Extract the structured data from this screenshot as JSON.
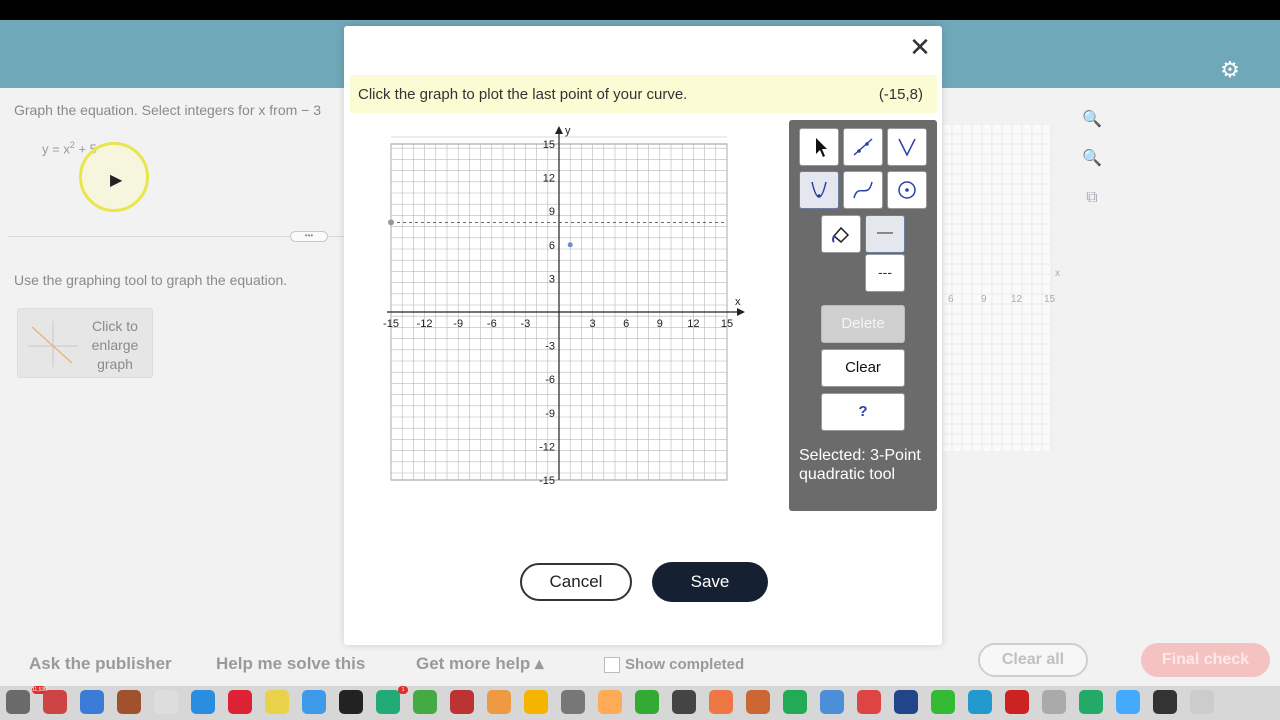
{
  "question": {
    "prompt": "Graph the equation. Select integers for x from  − 3",
    "equation_base": "y = x",
    "equation_exp": "2",
    "equation_rest": " + 5",
    "instruction": "Use the graphing tool to graph the equation.",
    "enlarge_label": "Click to enlarge graph",
    "divider_handle": "•••"
  },
  "modal": {
    "close_icon": "✕",
    "prompt": "Click the graph to plot the last point of your curve.",
    "coordinate": "(-15,8)",
    "cancel_label": "Cancel",
    "save_label": "Save"
  },
  "toolbox": {
    "delete_label": "Delete",
    "clear_label": "Clear",
    "help_label": "?",
    "selected_text": "Selected: 3-Point quadratic tool",
    "solid_line_label": "—",
    "dashed_line_label": "---"
  },
  "graph": {
    "x_axis_label": "x",
    "y_axis_label": "y",
    "x_ticks": [
      "-15",
      "-12",
      "-9",
      "-6",
      "-3",
      "3",
      "6",
      "9",
      "12",
      "15"
    ],
    "y_ticks": [
      "15",
      "12",
      "9",
      "6",
      "3",
      "-3",
      "-6",
      "-9",
      "-12",
      "-15"
    ],
    "curve_color": "#3a2fb0",
    "grid_color": "#9a9a9a"
  },
  "footer": {
    "ask_publisher": "Ask the publisher",
    "help_solve": "Help me solve this",
    "get_more_help": "Get more help ▴",
    "show_completed": "Show completed",
    "clear_all": "Clear all",
    "final_check": "Final check"
  },
  "background_graph": {
    "x_label": "x",
    "ticks": [
      "6",
      "9",
      "12",
      "15"
    ]
  },
  "icons": {
    "gear": "⚙",
    "zoom_in": "🔍",
    "zoom_out": "🔍",
    "popout": "⧉"
  },
  "dock_badges": [
    "11,536",
    "1"
  ]
}
